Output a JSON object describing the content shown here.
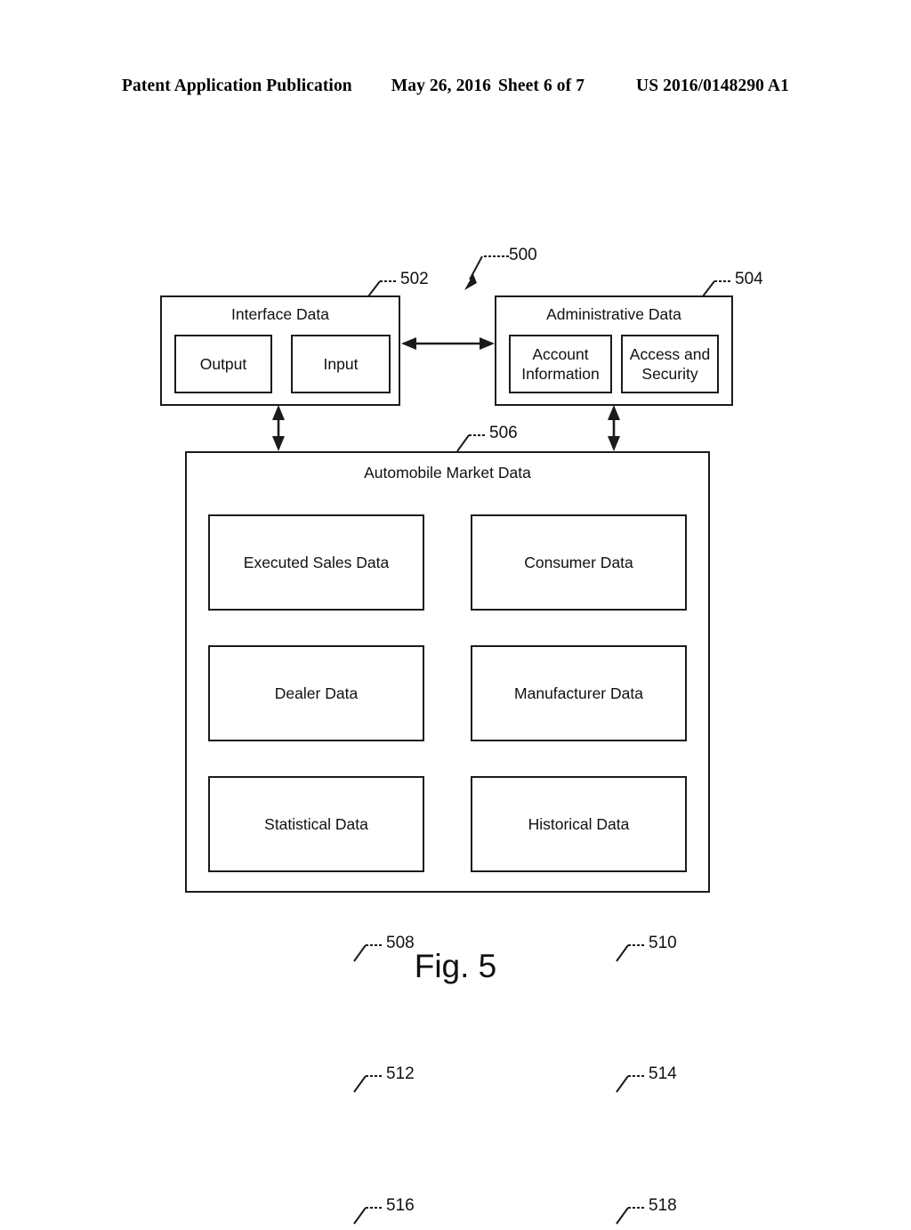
{
  "header": {
    "publication": "Patent Application Publication",
    "date": "May 26, 2016",
    "sheet": "Sheet 6 of 7",
    "number": "US 2016/0148290 A1"
  },
  "figure": {
    "caption": "Fig. 5",
    "system_ref": "500"
  },
  "diagram": {
    "interface_data": {
      "ref": "502",
      "title": "Interface Data",
      "children": [
        {
          "label": "Output"
        },
        {
          "label": "Input"
        }
      ]
    },
    "administrative_data": {
      "ref": "504",
      "title": "Administrative Data",
      "children": [
        {
          "label": "Account\nInformation"
        },
        {
          "label": "Access and\nSecurity"
        }
      ]
    },
    "automobile_market_data": {
      "ref": "506",
      "title": "Automobile Market Data",
      "children": [
        {
          "ref": "508",
          "label": "Executed Sales Data"
        },
        {
          "ref": "510",
          "label": "Consumer Data"
        },
        {
          "ref": "512",
          "label": "Dealer Data"
        },
        {
          "ref": "514",
          "label": "Manufacturer Data"
        },
        {
          "ref": "516",
          "label": "Statistical Data"
        },
        {
          "ref": "518",
          "label": "Historical Data"
        }
      ]
    },
    "connectors": [
      {
        "name": "interface-to-administrative",
        "style": "double-headed-horizontal"
      },
      {
        "name": "interface-to-market",
        "style": "double-headed-vertical"
      },
      {
        "name": "administrative-to-market",
        "style": "double-headed-vertical"
      }
    ]
  },
  "colors": {
    "line": "#1b1b1b",
    "text": "#111111",
    "background": "#ffffff"
  }
}
